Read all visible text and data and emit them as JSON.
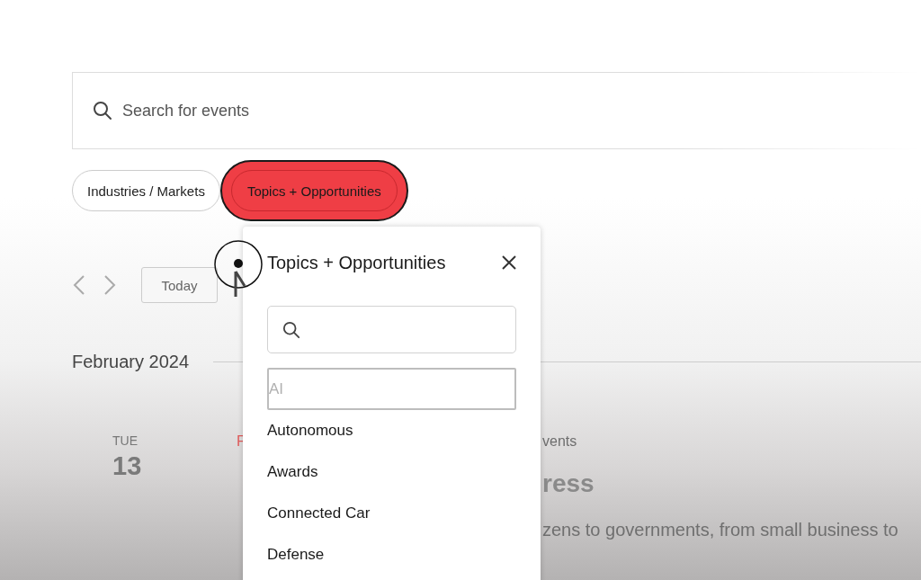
{
  "search": {
    "placeholder": "Search for events"
  },
  "filters": [
    {
      "label": "Industries / Markets",
      "selected": false
    },
    {
      "label": "Topics + Opportunities",
      "selected": true
    }
  ],
  "calendar_nav": {
    "today_button": "Today"
  },
  "month": "February 2024",
  "event": {
    "weekday": "TUE",
    "day": "13",
    "category_left": "F",
    "category_right": "vents",
    "title_right": "ress",
    "description_right": "zens to governments, from small business to"
  },
  "popup": {
    "title": "Topics + Opportunities",
    "options": [
      {
        "label": "AI",
        "kind": "field"
      },
      {
        "label": "Autonomous",
        "kind": "plain"
      },
      {
        "label": "Awards",
        "kind": "plain"
      },
      {
        "label": "Connected Car",
        "kind": "plain"
      },
      {
        "label": "Defense",
        "kind": "plain"
      }
    ]
  }
}
